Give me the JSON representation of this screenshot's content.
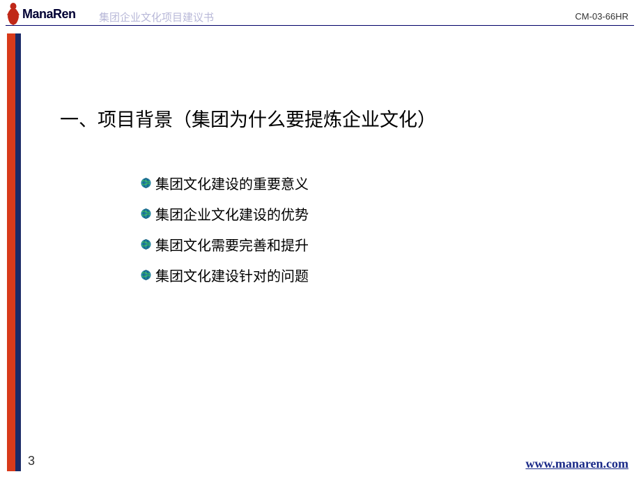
{
  "logo": {
    "text": "ManaRen"
  },
  "header": {
    "title": "集团企业文化项目建议书",
    "code": "CM-03-66HR"
  },
  "main": {
    "heading": "一、项目背景（集团为什么要提炼企业文化）",
    "bullets": [
      "集团文化建设的重要意义",
      "集团企业文化建设的优势",
      "集团文化需要完善和提升",
      "集团文化建设针对的问题"
    ]
  },
  "footer": {
    "page_number": "3",
    "url": "www.manaren.com"
  }
}
